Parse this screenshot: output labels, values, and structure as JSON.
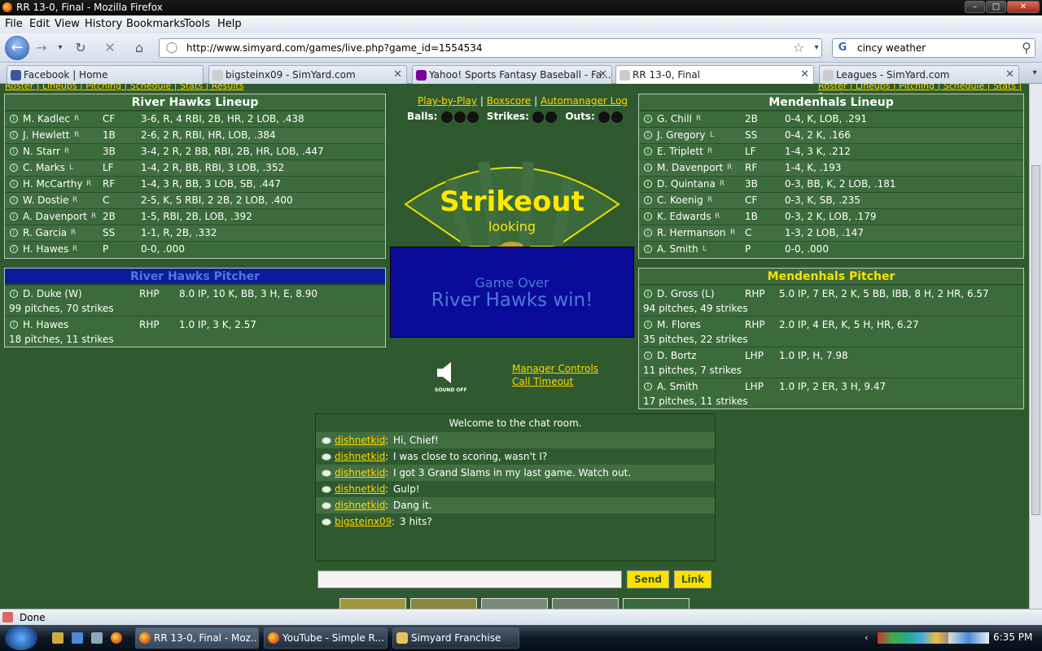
{
  "window": {
    "title": "RR 13-0, Final - Mozilla Firefox",
    "min": "–",
    "max": "□",
    "close": "✕"
  },
  "menu": [
    "File",
    "Edit",
    "View",
    "History",
    "Bookmarks",
    "Tools",
    "Help"
  ],
  "nav": {
    "url": "http://www.simyard.com/games/live.php?game_id=1554534",
    "search": "cincy weather"
  },
  "tabs": [
    {
      "label": "Facebook | Home",
      "color": "#3b5998"
    },
    {
      "label": "bigsteinx09 - SimYard.com",
      "color": "#ccc"
    },
    {
      "label": "Yahoo! Sports Fantasy Baseball - Fa...",
      "color": "#7b0099"
    },
    {
      "label": "RR 13-0, Final",
      "color": "#ccc"
    },
    {
      "label": "Leagues - SimYard.com",
      "color": "#ccc"
    }
  ],
  "toplinks": {
    "left": "Roster | Lineups | Pitching | Schedule | Stats | Results",
    "right": "Roster | Lineups | Pitching | Schedule | Stats | Results"
  },
  "home": {
    "title": "River Hawks Lineup",
    "players": [
      {
        "name": "M. Kadlec",
        "hand": "R",
        "pos": "CF",
        "line": "3-6, R, 4 RBI, 2B, HR, 2 LOB, .438"
      },
      {
        "name": "J. Hewlett",
        "hand": "R",
        "pos": "1B",
        "line": "2-6, 2 R, RBI, HR, LOB, .384"
      },
      {
        "name": "N. Starr",
        "hand": "R",
        "pos": "3B",
        "line": "3-4, 2 R, 2 BB, RBI, 2B, HR, LOB, .447"
      },
      {
        "name": "C. Marks",
        "hand": "L",
        "pos": "LF",
        "line": "1-4, 2 R, BB, RBI, 3 LOB, .352"
      },
      {
        "name": "H. McCarthy",
        "hand": "R",
        "pos": "RF",
        "line": "1-4, 3 R, BB, 3 LOB, SB, .447"
      },
      {
        "name": "W. Dostie",
        "hand": "R",
        "pos": "C",
        "line": "2-5, K, 5 RBI, 2 2B, 2 LOB, .400"
      },
      {
        "name": "A. Davenport",
        "hand": "R",
        "pos": "2B",
        "line": "1-5, RBI, 2B, LOB, .392"
      },
      {
        "name": "R. Garcia",
        "hand": "R",
        "pos": "SS",
        "line": "1-1, R, 2B, .332"
      },
      {
        "name": "H. Hawes",
        "hand": "R",
        "pos": "P",
        "line": "0-0, .000"
      }
    ],
    "pitcher_title": "River Hawks Pitcher",
    "pitchers": [
      {
        "name": "D. Duke (W)",
        "throws": "RHP",
        "line": "8.0 IP, 10 K, BB, 3 H, E, 8.90",
        "count": "99 pitches, 70 strikes"
      },
      {
        "name": "H. Hawes",
        "throws": "RHP",
        "line": "1.0 IP, 3 K, 2.57",
        "count": "18 pitches, 11 strikes"
      }
    ]
  },
  "away": {
    "title": "Mendenhals Lineup",
    "players": [
      {
        "name": "G. Chill",
        "hand": "R",
        "pos": "2B",
        "line": "0-4, K, LOB, .291"
      },
      {
        "name": "J. Gregory",
        "hand": "L",
        "pos": "SS",
        "line": "0-4, 2 K, .166"
      },
      {
        "name": "E. Triplett",
        "hand": "R",
        "pos": "LF",
        "line": "1-4, 3 K, .212"
      },
      {
        "name": "M. Davenport",
        "hand": "R",
        "pos": "RF",
        "line": "1-4, K, .193"
      },
      {
        "name": "D. Quintana",
        "hand": "R",
        "pos": "3B",
        "line": "0-3, BB, K, 2 LOB, .181"
      },
      {
        "name": "C. Koenig",
        "hand": "R",
        "pos": "CF",
        "line": "0-3, K, SB, .235"
      },
      {
        "name": "K. Edwards",
        "hand": "R",
        "pos": "1B",
        "line": "0-3, 2 K, LOB, .179"
      },
      {
        "name": "R. Hermanson",
        "hand": "R",
        "pos": "C",
        "line": "1-3, 2 LOB, .147"
      },
      {
        "name": "A. Smith",
        "hand": "L",
        "pos": "P",
        "line": "0-0, .000"
      }
    ],
    "pitcher_title": "Mendenhals Pitcher",
    "pitchers": [
      {
        "name": "D. Gross (L)",
        "throws": "RHP",
        "line": "5.0 IP, 7 ER, 2 K, 5 BB, IBB, 8 H, 2 HR, 6.57",
        "count": "94 pitches, 49 strikes"
      },
      {
        "name": "M. Flores",
        "throws": "RHP",
        "line": "2.0 IP, 4 ER, K, 5 H, HR, 6.27",
        "count": "35 pitches, 22 strikes"
      },
      {
        "name": "D. Bortz",
        "throws": "LHP",
        "line": "1.0 IP, H, 7.98",
        "count": "11 pitches, 7 strikes"
      },
      {
        "name": "A. Smith",
        "throws": "LHP",
        "line": "1.0 IP, 2 ER, 3 H, 9.47",
        "count": "17 pitches, 11 strikes"
      }
    ]
  },
  "center": {
    "link1": "Play-by-Play",
    "link2": "Boxscore",
    "link3": "Automanager Log",
    "sep": "|",
    "balls": "Balls:",
    "strikes": "Strikes:",
    "outs": "Outs:",
    "play": "Strikeout",
    "play_sub": "looking",
    "gameover": "Game Over",
    "winner": "River Hawks win!",
    "sound": "SOUND OFF",
    "manager": "Manager Controls",
    "timeout": "Call Timeout"
  },
  "chat": {
    "welcome": "Welcome to the chat room.",
    "messages": [
      {
        "user": "dishnetkid",
        "text": "Hi, Chief!"
      },
      {
        "user": "dishnetkid",
        "text": "I was close to scoring, wasn't I?"
      },
      {
        "user": "dishnetkid",
        "text": "I got 3 Grand Slams in my last game. Watch out."
      },
      {
        "user": "dishnetkid",
        "text": "Gulp!"
      },
      {
        "user": "dishnetkid",
        "text": "Dang it."
      },
      {
        "user": "bigsteinx09",
        "text": "3 hits?"
      }
    ],
    "send": "Send",
    "link": "Link"
  },
  "status": "Done",
  "taskbar": {
    "tasks": [
      "RR 13-0, Final - Moz...",
      "YouTube - Simple R...",
      "Simyard Franchise"
    ],
    "time": "6:35 PM"
  }
}
